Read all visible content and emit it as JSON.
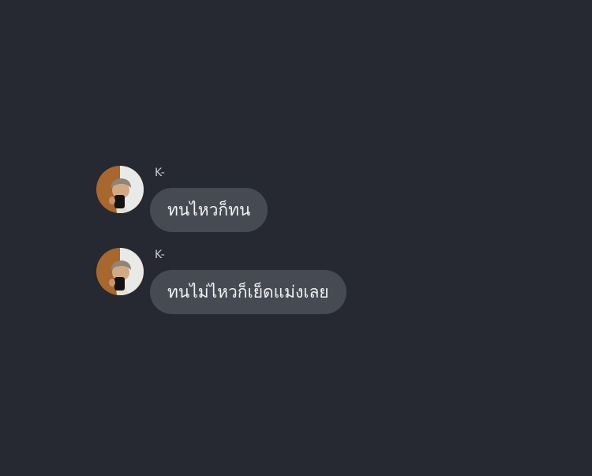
{
  "theme": {
    "background": "#262931",
    "bubble": "#464a53",
    "text": "#f2f2f4",
    "name": "#c9cbd0"
  },
  "messages": [
    {
      "sender": "K-",
      "text": "ทนไหวก็ทน",
      "avatar": "profile-photo"
    },
    {
      "sender": "K-",
      "text": "ทนไม่ไหวก็เย็ดแม่งเลย",
      "avatar": "profile-photo"
    }
  ]
}
